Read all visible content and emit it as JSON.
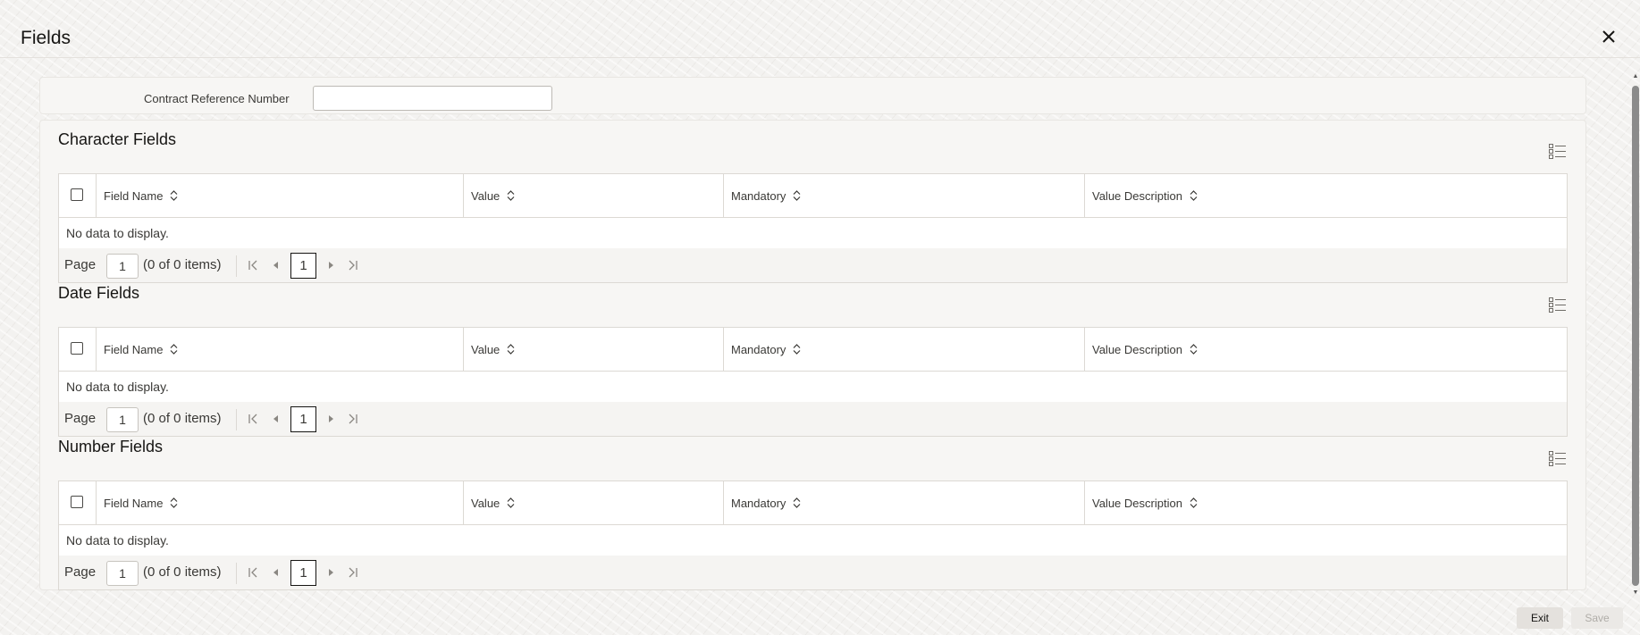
{
  "dialog": {
    "title": "Fields"
  },
  "filter": {
    "contract_ref_label": "Contract Reference Number",
    "contract_ref_value": ""
  },
  "columns": [
    "Field Name",
    "Value",
    "Mandatory",
    "Value Description"
  ],
  "sections": [
    {
      "title": "Character Fields",
      "no_data": "No data to display.",
      "pager": {
        "page_label": "Page",
        "page_input": "1",
        "count": "(0 of 0 items)",
        "current_page": "1"
      }
    },
    {
      "title": "Date Fields",
      "no_data": "No data to display.",
      "pager": {
        "page_label": "Page",
        "page_input": "1",
        "count": "(0 of 0 items)",
        "current_page": "1"
      }
    },
    {
      "title": "Number Fields",
      "no_data": "No data to display.",
      "pager": {
        "page_label": "Page",
        "page_input": "1",
        "count": "(0 of 0 items)",
        "current_page": "1"
      }
    }
  ],
  "footer": {
    "exit_label": "Exit",
    "save_label": "Save"
  },
  "icons": {
    "close": "close-icon",
    "list_view": "list-view-icon",
    "sort": "sort-icon",
    "first_page": "first-page-icon",
    "prev_page": "previous-page-icon",
    "next_page": "next-page-icon",
    "last_page": "last-page-icon"
  }
}
